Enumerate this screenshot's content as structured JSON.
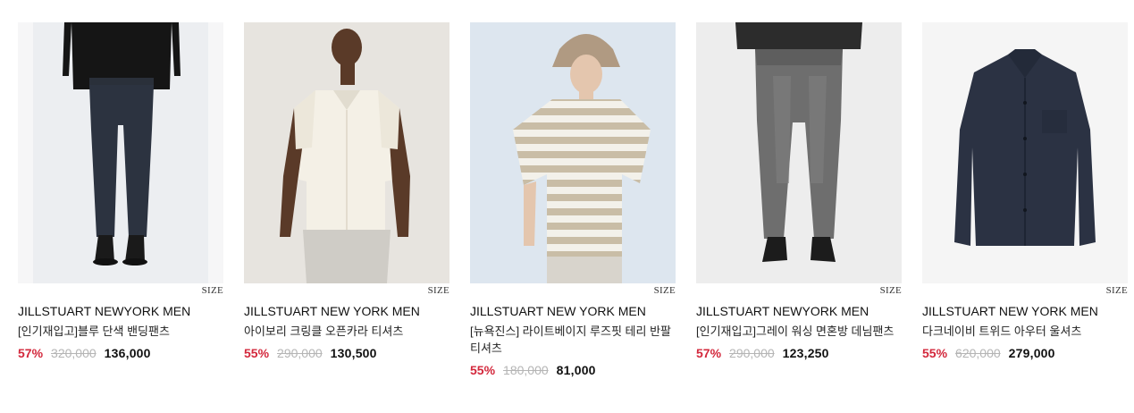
{
  "products": [
    {
      "brand": "JILLSTUART NEWYORK MEN",
      "name": "[인기재입고]블루 단색 밴딩팬츠",
      "discount": "57%",
      "original_price": "320,000",
      "price": "136,000",
      "size_label": "SIZE",
      "image": "model-navy-trousers"
    },
    {
      "brand": "JILLSTUART NEW YORK MEN",
      "name": "아이보리 크링클 오픈카라 티셔츠",
      "discount": "55%",
      "original_price": "290,000",
      "price": "130,500",
      "size_label": "SIZE",
      "image": "model-ivory-shirt"
    },
    {
      "brand": "JILLSTUART NEW YORK MEN",
      "name": "[뉴욕진스] 라이트베이지 루즈핏 테리 반팔 티셔츠",
      "discount": "55%",
      "original_price": "180,000",
      "price": "81,000",
      "size_label": "SIZE",
      "image": "model-striped-tee"
    },
    {
      "brand": "JILLSTUART NEWYORK MEN",
      "name": "[인기재입고]그레이 워싱 면혼방 데님팬츠",
      "discount": "57%",
      "original_price": "290,000",
      "price": "123,250",
      "size_label": "SIZE",
      "image": "model-grey-denim"
    },
    {
      "brand": "JILLSTUART NEW YORK MEN",
      "name": "다크네이비 트위드 아우터 울셔츠",
      "discount": "55%",
      "original_price": "620,000",
      "price": "279,000",
      "size_label": "SIZE",
      "image": "navy-tweed-jacket"
    }
  ],
  "colors": {
    "discount": "#d3283c",
    "original_price": "#b5b5b5",
    "text": "#111111"
  }
}
